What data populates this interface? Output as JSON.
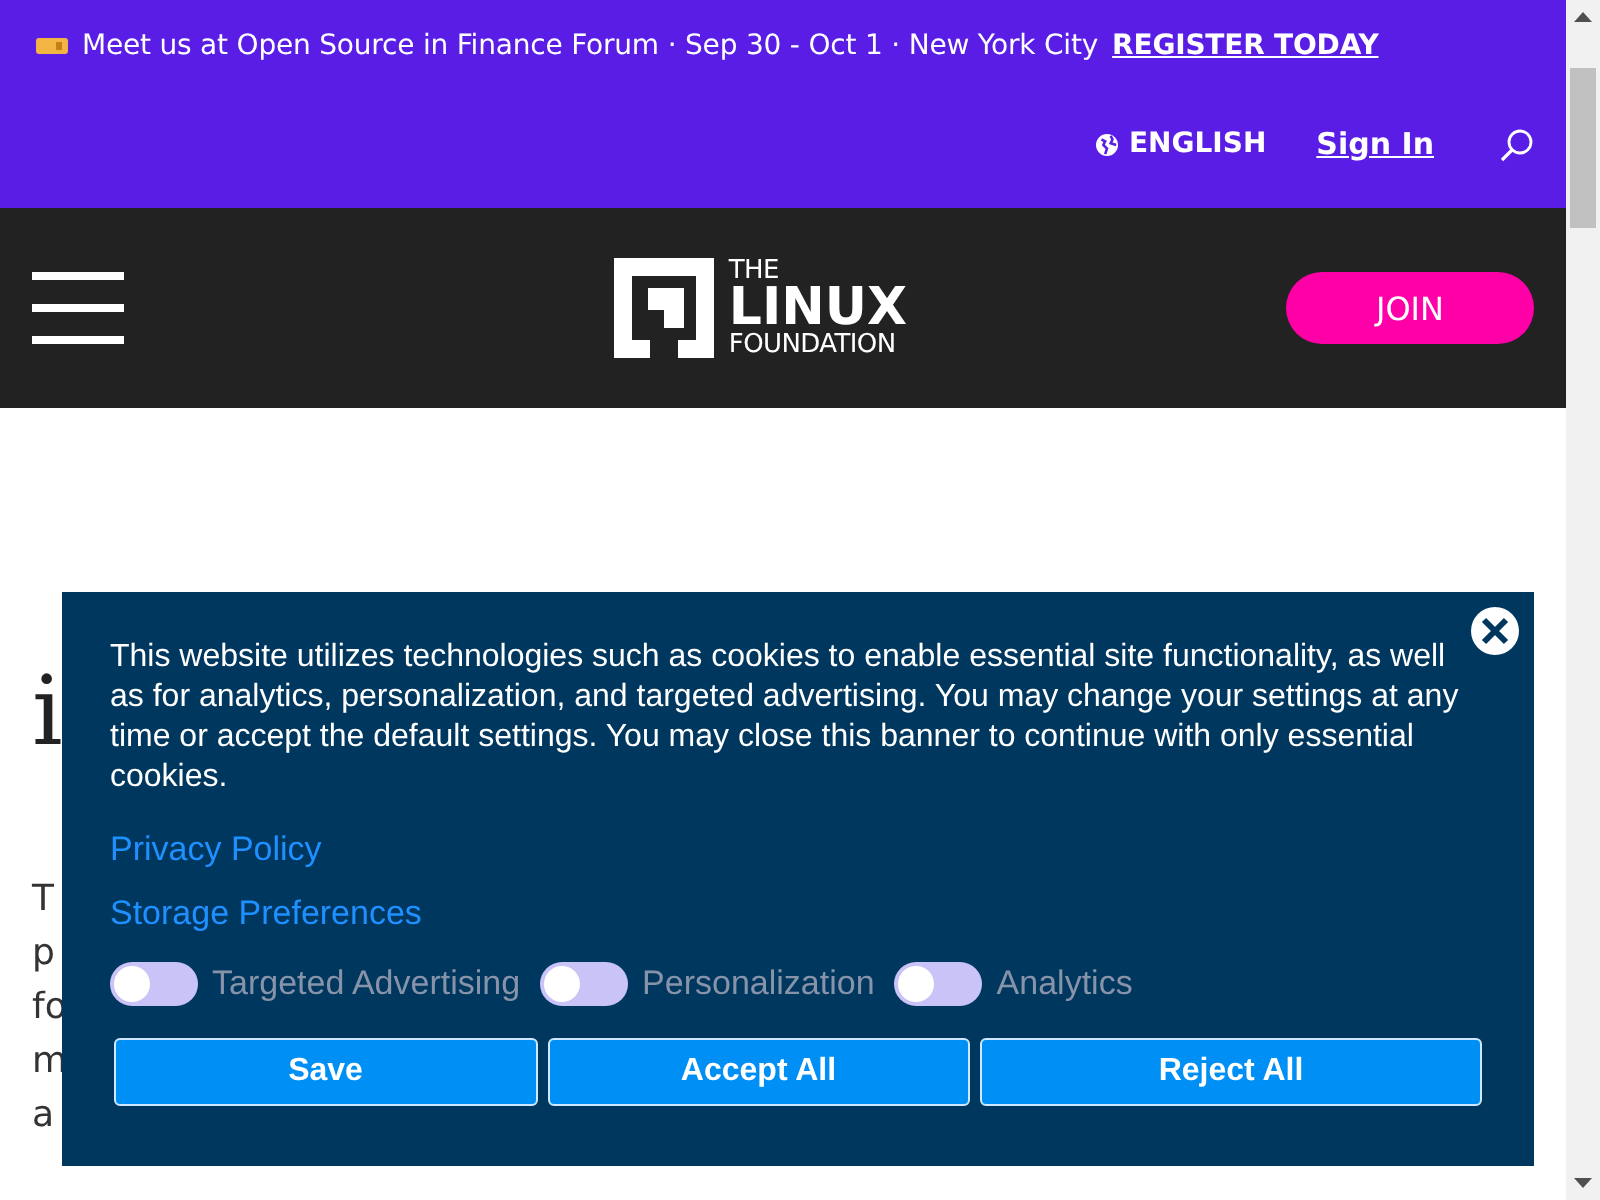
{
  "announcement": {
    "text": "Meet us at Open Source in Finance Forum · Sep 30 - Oct 1 · New York City",
    "link": "REGISTER TODAY"
  },
  "utility_nav": {
    "language": "ENGLISH",
    "sign_in": "Sign In"
  },
  "header": {
    "logo": [
      "THE",
      "LINUX",
      "FOUNDATION"
    ],
    "join": "JOIN"
  },
  "article": {
    "heading_lines": [
      "i"
    ],
    "paragraph_lines": [
      "T",
      "p",
      "fo",
      "m",
      "a"
    ]
  },
  "cookie_banner": {
    "text": "This website utilizes technologies such as cookies to enable essential site functionality, as well as for analytics, personalization, and targeted advertising. You may change your settings at any time or accept the default settings. You may close this banner to continue with only essential cookies.",
    "privacy_link": "Privacy Policy",
    "preferences_link": "Storage Preferences",
    "toggles": [
      {
        "label": "Targeted Advertising",
        "on": false
      },
      {
        "label": "Personalization",
        "on": false
      },
      {
        "label": "Analytics",
        "on": false
      }
    ],
    "buttons": [
      "Save",
      "Accept All",
      "Reject All"
    ]
  }
}
